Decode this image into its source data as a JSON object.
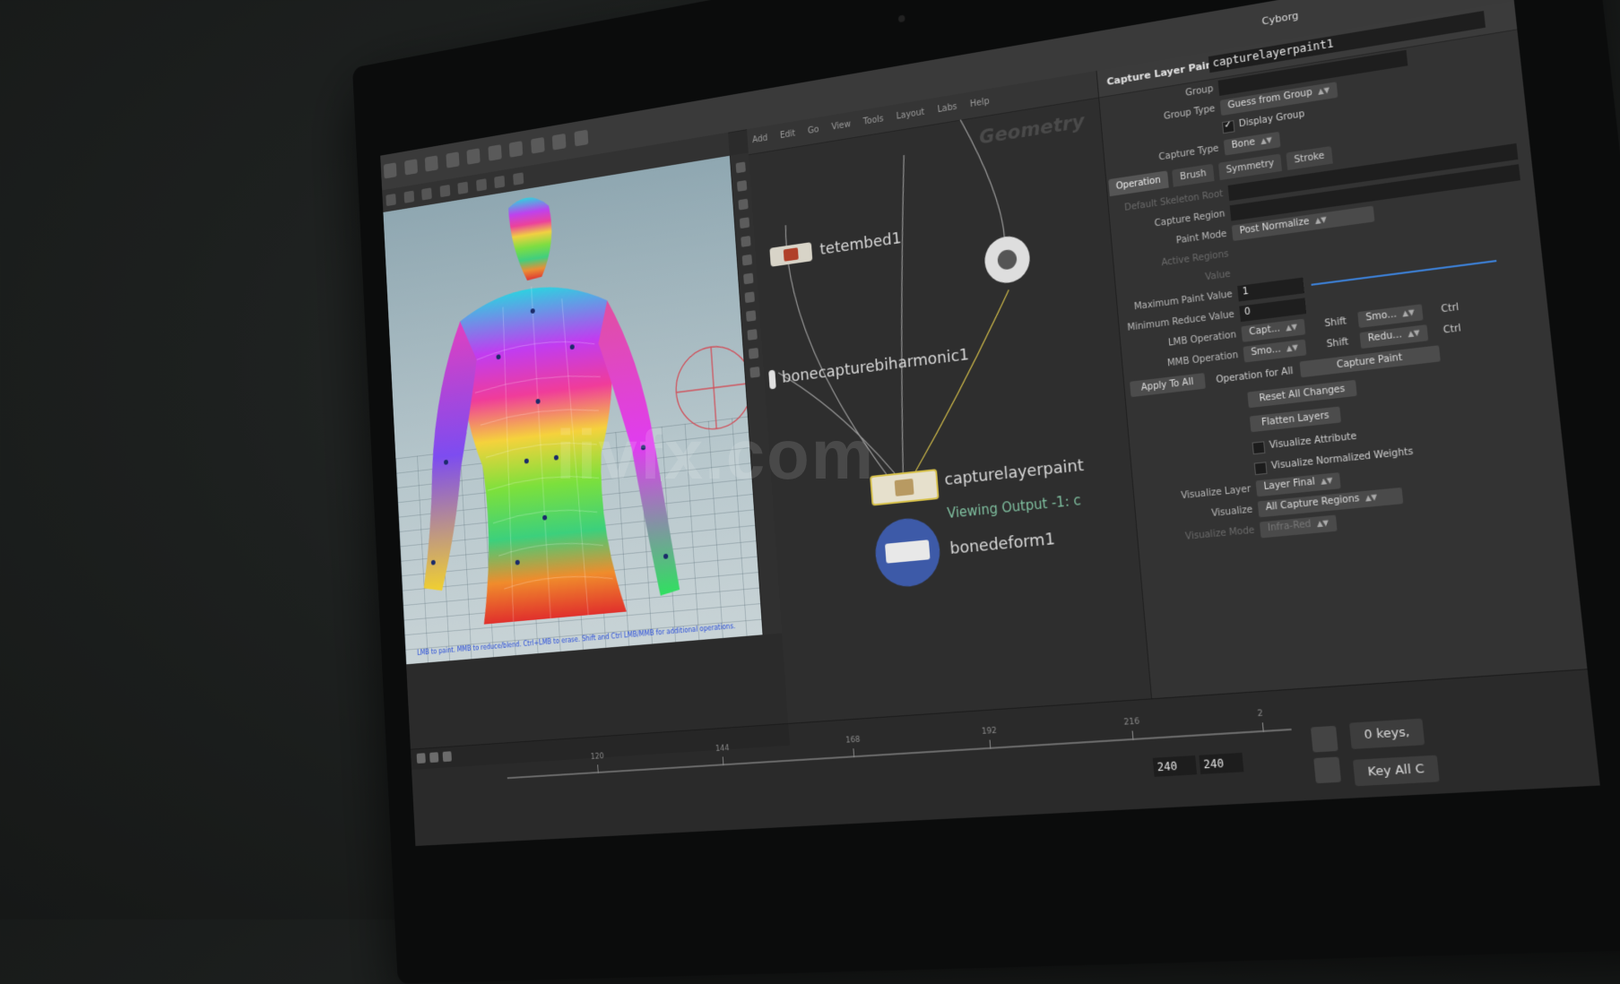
{
  "app": {
    "desktop": "Cyborg"
  },
  "viewport": {
    "help_text": "LMB to paint. MMB to reduce/blend. Ctrl+LMB to erase. Shift and Ctrl LMB/MMB for additional operations."
  },
  "network": {
    "menu": [
      "Add",
      "Edit",
      "Go",
      "View",
      "Tools",
      "Layout",
      "Labs",
      "Help"
    ],
    "context_label": "Geometry",
    "nodes": {
      "tetembed": "tetembed1",
      "bonecapture": "bonecapturebiharmonic1",
      "capturelayerpaint": "capturelayerpaint",
      "viewing_output": "Viewing Output -1: c",
      "bonedeform": "bonedeform1"
    }
  },
  "params": {
    "node_type": "Capture Layer Paint",
    "node_name": "capturelayerpaint1",
    "group_label": "Group",
    "group_type_label": "Group Type",
    "group_type_value": "Guess from Group",
    "display_group_label": "Display Group",
    "capture_type_label": "Capture Type",
    "capture_type_value": "Bone",
    "tabs": [
      "Operation",
      "Brush",
      "Symmetry",
      "Stroke"
    ],
    "default_skeleton_root_label": "Default Skeleton Root",
    "capture_region_label": "Capture Region",
    "paint_mode_label": "Paint Mode",
    "paint_mode_value": "Post Normalize",
    "active_regions_label": "Active Regions",
    "value_label": "Value",
    "max_paint_label": "Maximum Paint Value",
    "max_paint_value": "1",
    "min_reduce_label": "Minimum Reduce Value",
    "min_reduce_value": "0",
    "lmb_label": "LMB Operation",
    "lmb_value": "Capt...",
    "lmb_shift_label": "Shift",
    "lmb_shift_value": "Smo...",
    "lmb_ctrl_label": "Ctrl",
    "mmb_label": "MMB Operation",
    "mmb_value": "Smo...",
    "mmb_shift_label": "Shift",
    "mmb_shift_value": "Redu...",
    "mmb_ctrl_label": "Ctrl",
    "apply_to_all": "Apply To All",
    "op_for_all_label": "Operation for All",
    "op_for_all_value": "Capture Paint",
    "reset_all": "Reset All Changes",
    "flatten_layers": "Flatten Layers",
    "visualize_attribute": "Visualize Attribute",
    "visualize_normalized": "Visualize Normalized Weights",
    "visualize_layer_label": "Visualize Layer",
    "visualize_layer_value": "Layer Final",
    "visualize_label": "Visualize",
    "visualize_value": "All Capture Regions",
    "visualize_mode_label": "Visualize Mode",
    "visualize_mode_value": "Infra-Red"
  },
  "timeline": {
    "tick_labels": [
      "120",
      "144",
      "168",
      "192",
      "216",
      "2"
    ],
    "end_frame": "240",
    "end_frame2": "240",
    "keys_label": "0 keys,",
    "key_all": "Key All C"
  },
  "watermark": "iivfx.com"
}
